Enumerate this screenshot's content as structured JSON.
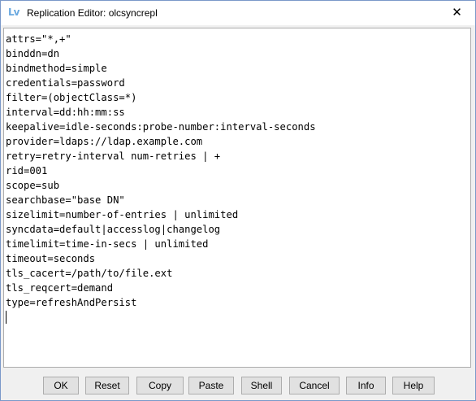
{
  "window": {
    "app_icon": "Lv",
    "title": "Replication Editor: olcsyncrepl",
    "close_glyph": "✕"
  },
  "editor": {
    "lines": [
      "attrs=\"*,+\"",
      "binddn=dn",
      "bindmethod=simple",
      "credentials=password",
      "filter=(objectClass=*)",
      "interval=dd:hh:mm:ss",
      "keepalive=idle-seconds:probe-number:interval-seconds",
      "provider=ldaps://ldap.example.com",
      "retry=retry-interval num-retries | +",
      "rid=001",
      "scope=sub",
      "searchbase=\"base DN\"",
      "sizelimit=number-of-entries | unlimited",
      "syncdata=default|accesslog|changelog",
      "timelimit=time-in-secs | unlimited",
      "timeout=seconds",
      "tls_cacert=/path/to/file.ext",
      "tls_reqcert=demand",
      "type=refreshAndPersist"
    ]
  },
  "buttons": {
    "ok": "OK",
    "reset": "Reset",
    "copy": "Copy",
    "paste": "Paste",
    "shell": "Shell",
    "cancel": "Cancel",
    "info": "Info",
    "help": "Help"
  }
}
